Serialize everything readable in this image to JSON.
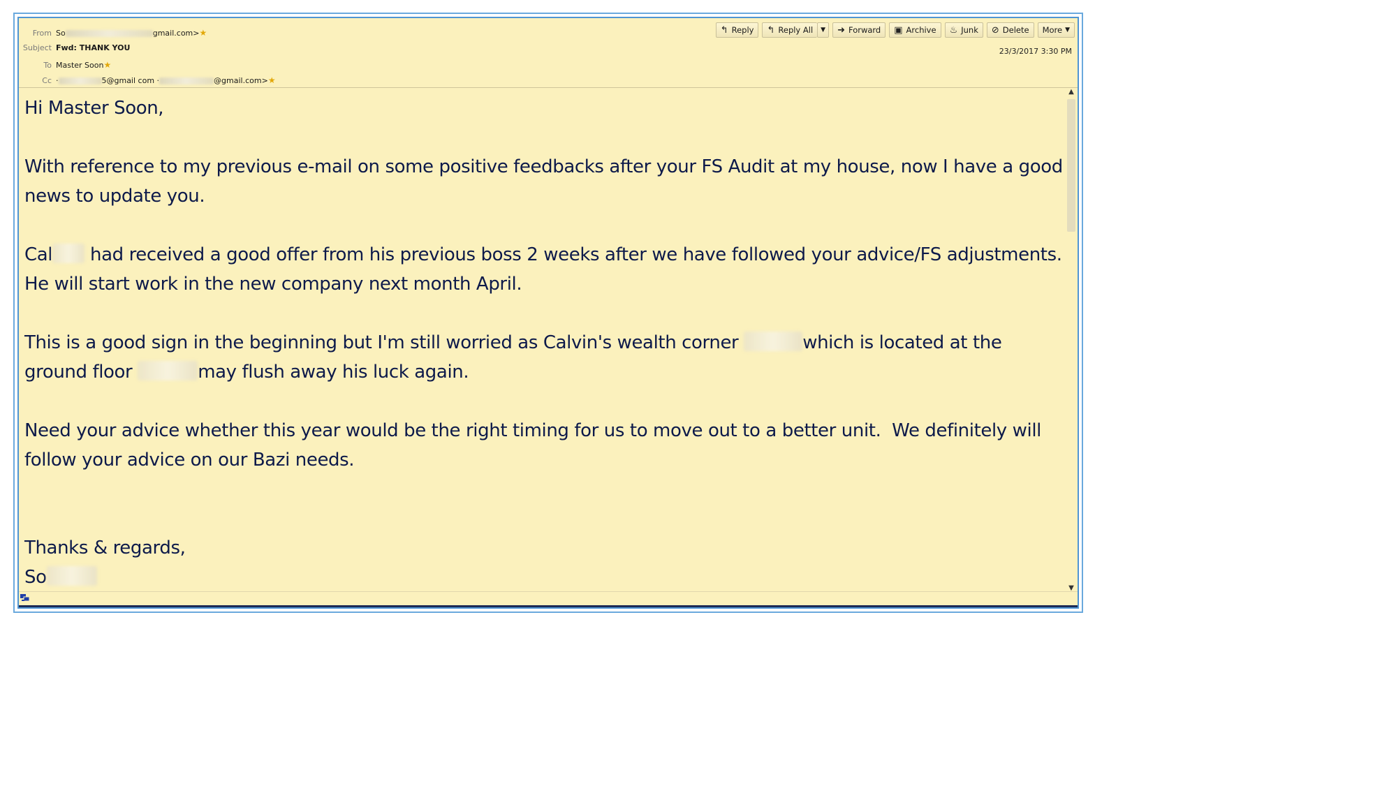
{
  "header": {
    "from_label": "From",
    "from_prefix": "So",
    "from_suffix": "gmail.com>",
    "subject_label": "Subject",
    "subject": "Fwd: THANK YOU",
    "to_label": "To",
    "to": "Master Soon",
    "cc_label": "Cc",
    "cc_1_prefix": "·",
    "cc_1_suffix": "5@gmail com ·",
    "cc_2_suffix": "@gmail.com>",
    "date": "23/3/2017 3:30 PM"
  },
  "toolbar": {
    "reply": "Reply",
    "reply_all": "Reply All",
    "forward": "Forward",
    "archive": "Archive",
    "junk": "Junk",
    "delete": "Delete",
    "more": "More"
  },
  "body": {
    "greeting": "Hi Master Soon,",
    "p1": "With reference to my previous e-mail on some positive feedbacks after your FS Audit at my house, now I have a good news to update you.",
    "p2_start": "Cal",
    "p2_rest": " had received a good offer from his previous boss 2 weeks after we have followed your advice/FS adjustments.  He will start work in the new company next month April.",
    "p3_a": "This is a good sign in the beginning but I'm still worried as Calvin's wealth corner ",
    "p3_b": "which is located at the ground floor ",
    "p3_c": "may flush away his luck again.",
    "p4": "Need your advice whether this year would be the right timing for us to move out to a better unit.  We definitely will follow your advice on our Bazi needs.",
    "signoff": "Thanks & regards,",
    "signature": "So"
  }
}
